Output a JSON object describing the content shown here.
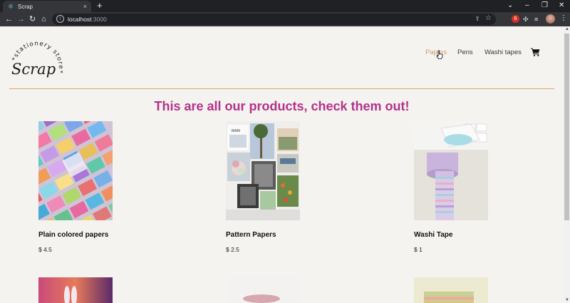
{
  "browser": {
    "tab_title": "Scrap",
    "url_host": "localhost",
    "url_port": ":3000",
    "new_tab": "+",
    "back": "←",
    "forward": "→",
    "reload": "↻",
    "home": "⌂",
    "tab_close": "×"
  },
  "site": {
    "logo_text": "Scrap",
    "logo_tagline": "*stationery store*",
    "nav": [
      {
        "label": "Papers",
        "active": true
      },
      {
        "label": "Pens",
        "active": false
      },
      {
        "label": "Washi tapes",
        "active": false
      }
    ],
    "headline": "This are all our products, check them out!",
    "accent_color": "#b5308b",
    "nav_active_color": "#c9a063"
  },
  "products": [
    {
      "name": "Plain colored papers",
      "price": "$ 4.5",
      "image": "colored-papers-image"
    },
    {
      "name": "Pattern Papers",
      "price": "$ 2.5",
      "image": "pattern-papers-image"
    },
    {
      "name": "Washi Tape",
      "price": "$ 1",
      "image": "washi-tape-image"
    }
  ]
}
